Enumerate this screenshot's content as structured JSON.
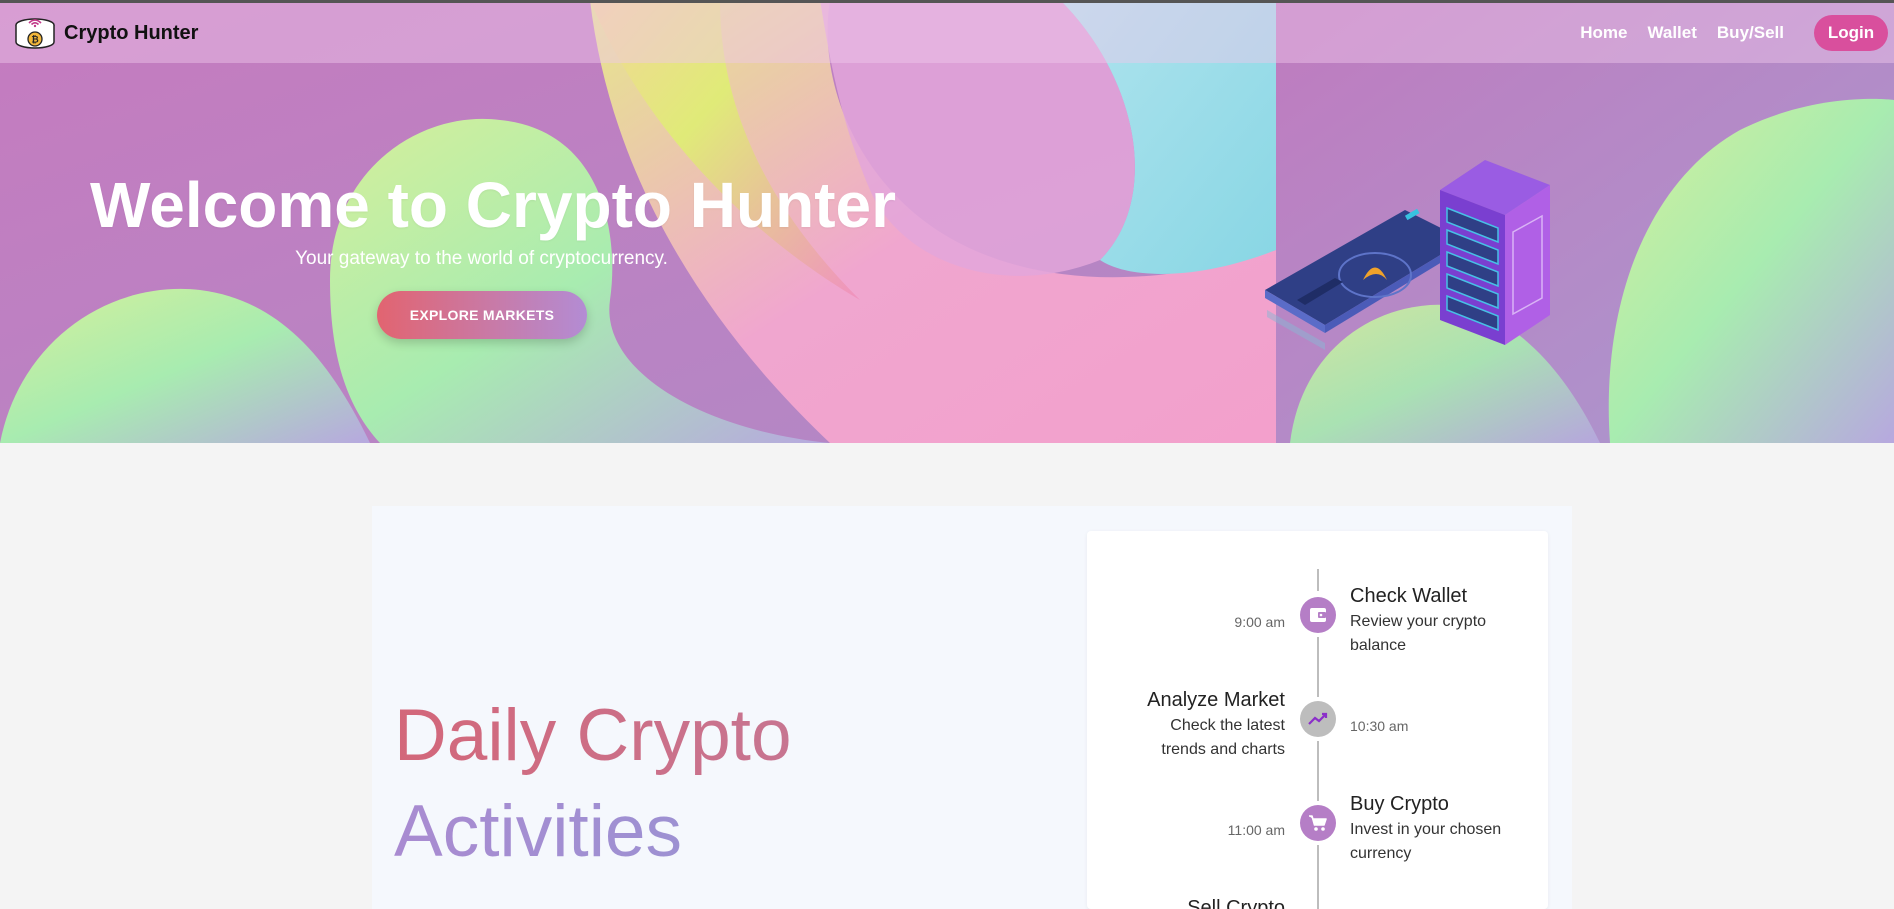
{
  "app": {
    "brand_name": "Crypto Hunter",
    "logo_icon": "crypto-safe-logo-icon"
  },
  "nav": {
    "links": [
      "Home",
      "Wallet",
      "Buy/Sell"
    ],
    "login_label": "Login"
  },
  "hero": {
    "title": "Welcome to Crypto Hunter",
    "subtitle": "Your gateway to the world of cryptocurrency.",
    "cta_label": "EXPLORE MARKETS",
    "illustration": "crypto-server-wallet-illustration"
  },
  "activities": {
    "title_line1": "Daily Crypto",
    "title_line2": "Activities",
    "timeline": [
      {
        "time": "9:00 am",
        "title": "Check Wallet",
        "description": "Review your crypto balance",
        "icon": "wallet-icon",
        "dot_color": "#b57ec6"
      },
      {
        "time": "10:30 am",
        "title": "Analyze Market",
        "description": "Check the latest trends and charts",
        "icon": "trending-up-icon",
        "dot_color": "#bdbdbd"
      },
      {
        "time": "11:00 am",
        "title": "Buy Crypto",
        "description": "Invest in your chosen currency",
        "icon": "shopping-cart-icon",
        "dot_color": "#b57ec6"
      },
      {
        "time": "",
        "title": "Sell Crypto",
        "description": "",
        "icon": "",
        "dot_color": ""
      }
    ]
  },
  "colors": {
    "login_bg": "#d94f9d",
    "cta_gradient_start": "#e26470",
    "cta_gradient_end": "#b38cd4",
    "timeline_purple": "#b57ec6",
    "timeline_grey": "#bdbdbd",
    "title_pink": "#cf6a7d",
    "title_purple": "#a88ad0"
  }
}
